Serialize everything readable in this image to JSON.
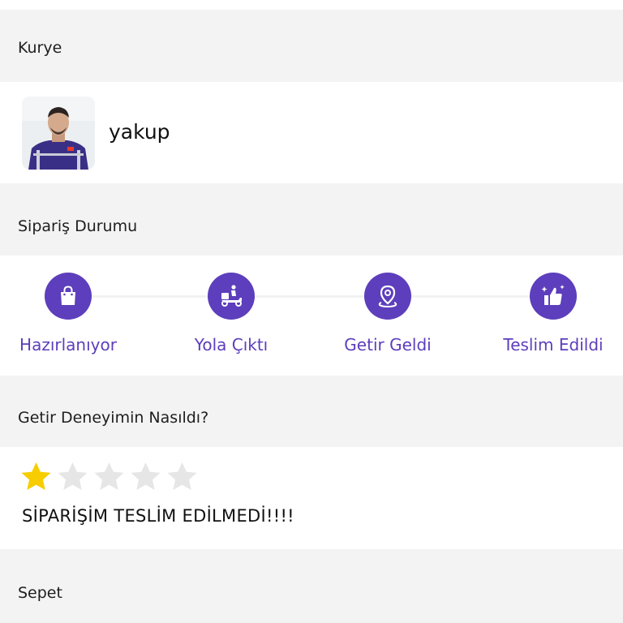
{
  "courier_section": {
    "title": "Kurye",
    "name": "yakup"
  },
  "order_status_section": {
    "title": "Sipariş Durumu",
    "steps": [
      {
        "label": "Hazırlanıyor",
        "icon": "shopping-bag-icon"
      },
      {
        "label": "Yola Çıktı",
        "icon": "delivery-scooter-icon"
      },
      {
        "label": "Getir Geldi",
        "icon": "location-pin-icon"
      },
      {
        "label": "Teslim Edildi",
        "icon": "thumbs-up-icon"
      }
    ],
    "accent_color": "#5d3ebc"
  },
  "experience_section": {
    "title": "Getir Deneyimin Nasıldı?",
    "rating": 1,
    "max_rating": 5,
    "review": "SİPARİŞİM TESLİM EDİLMEDİ!!!!",
    "star_filled_color": "#f7cd00",
    "star_empty_color": "#e6e6e6"
  },
  "basket_section": {
    "title": "Sepet"
  }
}
